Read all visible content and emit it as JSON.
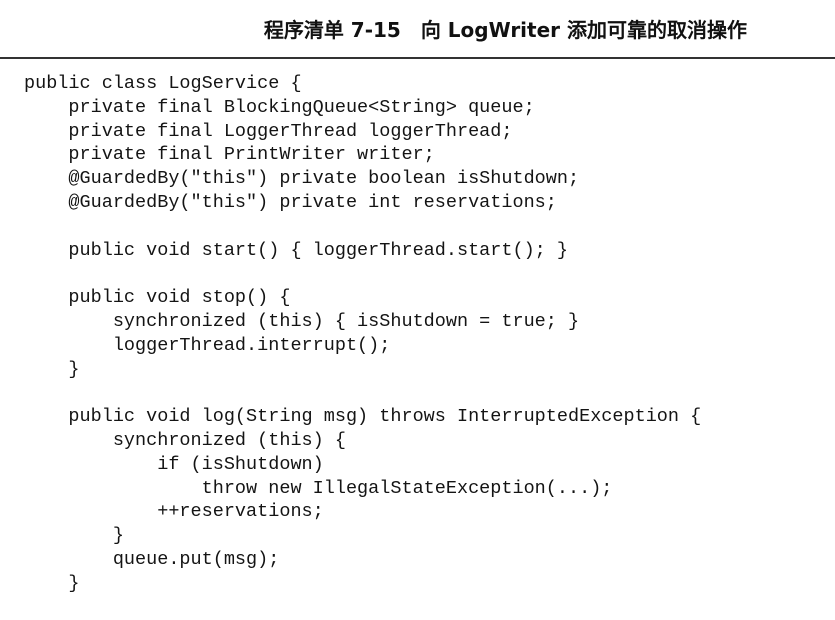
{
  "listing": {
    "label": "程序清单 7-15",
    "caption": "向 LogWriter 添加可靠的取消操作"
  },
  "code_lines": [
    "public class LogService {",
    "    private final BlockingQueue<String> queue;",
    "    private final LoggerThread loggerThread;",
    "    private final PrintWriter writer;",
    "    @GuardedBy(\"this\") private boolean isShutdown;",
    "    @GuardedBy(\"this\") private int reservations;",
    "",
    "    public void start() { loggerThread.start(); }",
    "",
    "    public void stop() {",
    "        synchronized (this) { isShutdown = true; }",
    "        loggerThread.interrupt();",
    "    }",
    "",
    "    public void log(String msg) throws InterruptedException {",
    "        synchronized (this) {",
    "            if (isShutdown)",
    "                throw new IllegalStateException(...);",
    "            ++reservations;",
    "        }",
    "        queue.put(msg);",
    "    }"
  ]
}
